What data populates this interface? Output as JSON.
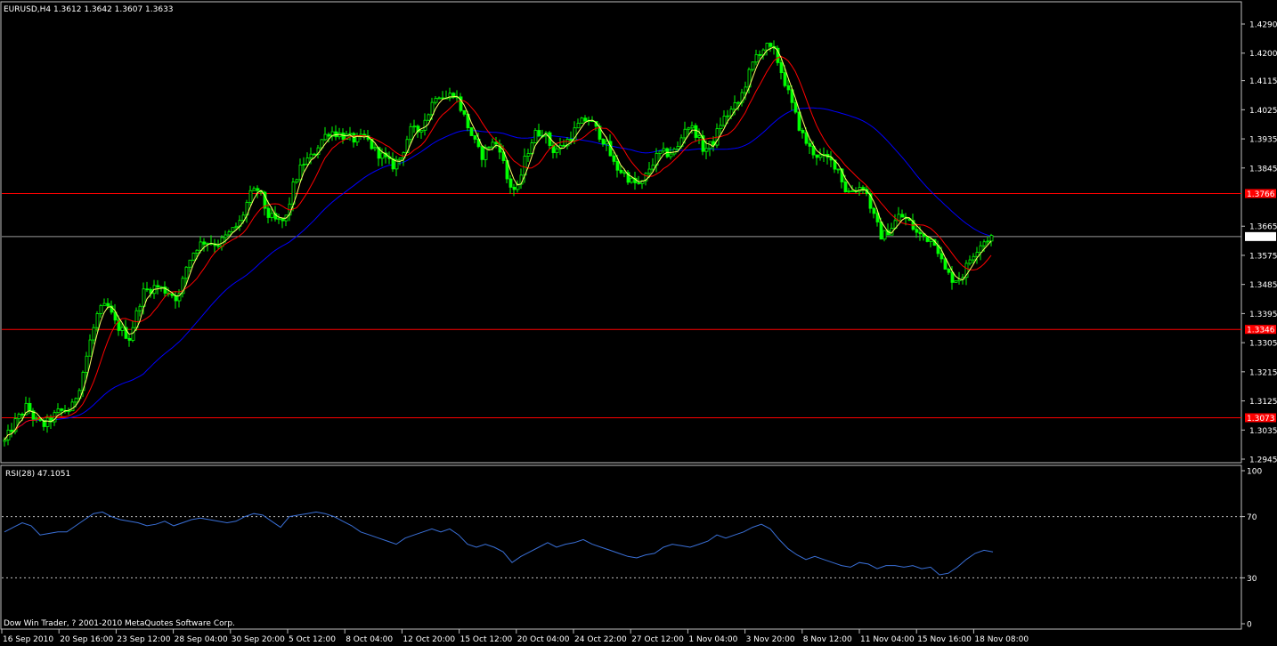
{
  "window": {
    "symbol_header": "EURUSD,H4  1.3612 1.3642 1.3607 1.3633",
    "copyright": "Dow Win Trader, ? 2001-2010 MetaQuotes Software Corp."
  },
  "colors": {
    "background": "#000000",
    "frame": "#c0c0c0",
    "candles": "#00ff00",
    "ma_fast": "#ffff66",
    "ma_mid": "#ff0000",
    "ma_slow": "#0000ff",
    "rsi_line": "#3a70d8",
    "level_line": "#ff0000",
    "current_line": "#9a9a9a",
    "level_tag_bg": "#ff0000",
    "current_tag_bg": "#ffffff"
  },
  "chart_data": [
    {
      "type": "candlestick",
      "symbol": "EURUSD",
      "timeframe": "H4",
      "last_bar": {
        "open": 1.3612,
        "high": 1.3642,
        "low": 1.3607,
        "close": 1.3633
      },
      "y_ticks": [
        "1.4290",
        "1.4200",
        "1.4115",
        "1.4025",
        "1.3935",
        "1.3845",
        "1.3665",
        "1.3575",
        "1.3485",
        "1.3395",
        "1.3305",
        "1.3215",
        "1.3125",
        "1.3035",
        "1.2945"
      ],
      "ylim": [
        1.2945,
        1.429
      ],
      "x_tick_labels": [
        "16 Sep 2010",
        "20 Sep 16:00",
        "23 Sep 12:00",
        "28 Sep 04:00",
        "30 Sep 20:00",
        "5 Oct 12:00",
        "8 Oct 04:00",
        "12 Oct 20:00",
        "15 Oct 12:00",
        "20 Oct 04:00",
        "24 Oct 22:00",
        "27 Oct 12:00",
        "1 Nov 04:00",
        "3 Nov 20:00",
        "8 Nov 12:00",
        "11 Nov 04:00",
        "15 Nov 16:00",
        "18 Nov 08:00"
      ],
      "close_path": [
        [
          0,
          1.3
        ],
        [
          12,
          1.306
        ],
        [
          25,
          1.311
        ],
        [
          35,
          1.306
        ],
        [
          45,
          1.305
        ],
        [
          60,
          1.309
        ],
        [
          75,
          1.31
        ],
        [
          85,
          1.318
        ],
        [
          95,
          1.33
        ],
        [
          105,
          1.34
        ],
        [
          115,
          1.342
        ],
        [
          125,
          1.336
        ],
        [
          140,
          1.332
        ],
        [
          155,
          1.346
        ],
        [
          170,
          1.348
        ],
        [
          185,
          1.346
        ],
        [
          195,
          1.344
        ],
        [
          205,
          1.355
        ],
        [
          215,
          1.36
        ],
        [
          225,
          1.362
        ],
        [
          240,
          1.361
        ],
        [
          255,
          1.365
        ],
        [
          265,
          1.368
        ],
        [
          275,
          1.376
        ],
        [
          285,
          1.378
        ],
        [
          295,
          1.37
        ],
        [
          305,
          1.368
        ],
        [
          315,
          1.368
        ],
        [
          325,
          1.38
        ],
        [
          335,
          1.386
        ],
        [
          345,
          1.388
        ],
        [
          355,
          1.393
        ],
        [
          365,
          1.396
        ],
        [
          375,
          1.395
        ],
        [
          385,
          1.394
        ],
        [
          395,
          1.393
        ],
        [
          405,
          1.394
        ],
        [
          415,
          1.39
        ],
        [
          425,
          1.388
        ],
        [
          435,
          1.385
        ],
        [
          445,
          1.388
        ],
        [
          455,
          1.396
        ],
        [
          465,
          1.396
        ],
        [
          475,
          1.401
        ],
        [
          485,
          1.408
        ],
        [
          495,
          1.406
        ],
        [
          505,
          1.408
        ],
        [
          515,
          1.401
        ],
        [
          525,
          1.394
        ],
        [
          535,
          1.388
        ],
        [
          545,
          1.392
        ],
        [
          555,
          1.392
        ],
        [
          565,
          1.38
        ],
        [
          575,
          1.377
        ],
        [
          585,
          1.388
        ],
        [
          595,
          1.395
        ],
        [
          605,
          1.396
        ],
        [
          615,
          1.39
        ],
        [
          625,
          1.391
        ],
        [
          635,
          1.394
        ],
        [
          645,
          1.398
        ],
        [
          655,
          1.4
        ],
        [
          665,
          1.396
        ],
        [
          675,
          1.392
        ],
        [
          685,
          1.385
        ],
        [
          695,
          1.383
        ],
        [
          705,
          1.38
        ],
        [
          715,
          1.379
        ],
        [
          725,
          1.385
        ],
        [
          735,
          1.389
        ],
        [
          745,
          1.389
        ],
        [
          755,
          1.39
        ],
        [
          765,
          1.398
        ],
        [
          775,
          1.396
        ],
        [
          785,
          1.39
        ],
        [
          795,
          1.392
        ],
        [
          805,
          1.399
        ],
        [
          815,
          1.402
        ],
        [
          825,
          1.405
        ],
        [
          835,
          1.413
        ],
        [
          845,
          1.42
        ],
        [
          855,
          1.422
        ],
        [
          865,
          1.42
        ],
        [
          875,
          1.412
        ],
        [
          885,
          1.403
        ],
        [
          895,
          1.395
        ],
        [
          905,
          1.39
        ],
        [
          915,
          1.388
        ],
        [
          925,
          1.387
        ],
        [
          935,
          1.385
        ],
        [
          945,
          1.377
        ],
        [
          955,
          1.378
        ],
        [
          965,
          1.379
        ],
        [
          975,
          1.37
        ],
        [
          985,
          1.363
        ],
        [
          995,
          1.366
        ],
        [
          1005,
          1.37
        ],
        [
          1015,
          1.368
        ],
        [
          1025,
          1.364
        ],
        [
          1035,
          1.363
        ],
        [
          1045,
          1.362
        ],
        [
          1055,
          1.353
        ],
        [
          1065,
          1.35
        ],
        [
          1075,
          1.351
        ],
        [
          1085,
          1.357
        ],
        [
          1095,
          1.361
        ],
        [
          1105,
          1.363
        ],
        [
          1110,
          1.3633
        ]
      ],
      "horizontal_lines": [
        {
          "price": 1.3766,
          "label": "1.3766",
          "kind": "level"
        },
        {
          "price": 1.3346,
          "label": "1.3346",
          "kind": "level"
        },
        {
          "price": 1.3073,
          "label": "1.3073",
          "kind": "level"
        },
        {
          "price": 1.3633,
          "label": "1.3633",
          "kind": "current"
        }
      ]
    },
    {
      "type": "line",
      "name": "RSI(28)",
      "label": "RSI(28) 47.1051",
      "ylim": [
        0,
        100
      ],
      "y_ticks": [
        "100",
        "70",
        "30",
        "0"
      ],
      "levels": [
        70,
        30
      ],
      "values": [
        [
          0,
          60
        ],
        [
          10,
          63
        ],
        [
          20,
          66
        ],
        [
          30,
          64
        ],
        [
          40,
          58
        ],
        [
          50,
          59
        ],
        [
          60,
          60
        ],
        [
          70,
          60
        ],
        [
          80,
          64
        ],
        [
          90,
          68
        ],
        [
          100,
          72
        ],
        [
          110,
          73
        ],
        [
          120,
          70
        ],
        [
          130,
          68
        ],
        [
          140,
          67
        ],
        [
          150,
          66
        ],
        [
          160,
          64
        ],
        [
          170,
          65
        ],
        [
          180,
          67
        ],
        [
          190,
          64
        ],
        [
          200,
          66
        ],
        [
          210,
          68
        ],
        [
          220,
          69
        ],
        [
          230,
          68
        ],
        [
          240,
          67
        ],
        [
          250,
          66
        ],
        [
          260,
          67
        ],
        [
          270,
          70
        ],
        [
          280,
          72
        ],
        [
          290,
          71
        ],
        [
          300,
          67
        ],
        [
          310,
          63
        ],
        [
          320,
          70
        ],
        [
          330,
          71
        ],
        [
          340,
          72
        ],
        [
          350,
          73
        ],
        [
          360,
          72
        ],
        [
          370,
          70
        ],
        [
          380,
          67
        ],
        [
          390,
          64
        ],
        [
          400,
          60
        ],
        [
          410,
          58
        ],
        [
          420,
          56
        ],
        [
          430,
          54
        ],
        [
          440,
          52
        ],
        [
          450,
          56
        ],
        [
          460,
          58
        ],
        [
          470,
          60
        ],
        [
          480,
          62
        ],
        [
          490,
          60
        ],
        [
          500,
          62
        ],
        [
          510,
          58
        ],
        [
          520,
          52
        ],
        [
          530,
          50
        ],
        [
          540,
          52
        ],
        [
          550,
          50
        ],
        [
          560,
          47
        ],
        [
          570,
          40
        ],
        [
          580,
          44
        ],
        [
          590,
          47
        ],
        [
          600,
          50
        ],
        [
          610,
          53
        ],
        [
          620,
          50
        ],
        [
          630,
          52
        ],
        [
          640,
          53
        ],
        [
          650,
          55
        ],
        [
          660,
          52
        ],
        [
          670,
          50
        ],
        [
          680,
          48
        ],
        [
          690,
          46
        ],
        [
          700,
          44
        ],
        [
          710,
          43
        ],
        [
          720,
          45
        ],
        [
          730,
          46
        ],
        [
          740,
          50
        ],
        [
          750,
          52
        ],
        [
          760,
          51
        ],
        [
          770,
          50
        ],
        [
          780,
          52
        ],
        [
          790,
          54
        ],
        [
          800,
          58
        ],
        [
          810,
          56
        ],
        [
          820,
          58
        ],
        [
          830,
          60
        ],
        [
          840,
          63
        ],
        [
          850,
          65
        ],
        [
          860,
          62
        ],
        [
          870,
          55
        ],
        [
          880,
          49
        ],
        [
          890,
          45
        ],
        [
          900,
          42
        ],
        [
          910,
          44
        ],
        [
          920,
          42
        ],
        [
          930,
          40
        ],
        [
          940,
          38
        ],
        [
          950,
          37
        ],
        [
          960,
          40
        ],
        [
          970,
          39
        ],
        [
          980,
          36
        ],
        [
          990,
          38
        ],
        [
          1000,
          38
        ],
        [
          1010,
          37
        ],
        [
          1020,
          38
        ],
        [
          1030,
          36
        ],
        [
          1040,
          37
        ],
        [
          1050,
          32
        ],
        [
          1060,
          33
        ],
        [
          1070,
          37
        ],
        [
          1080,
          42
        ],
        [
          1090,
          46
        ],
        [
          1100,
          48
        ],
        [
          1110,
          47
        ]
      ]
    }
  ]
}
